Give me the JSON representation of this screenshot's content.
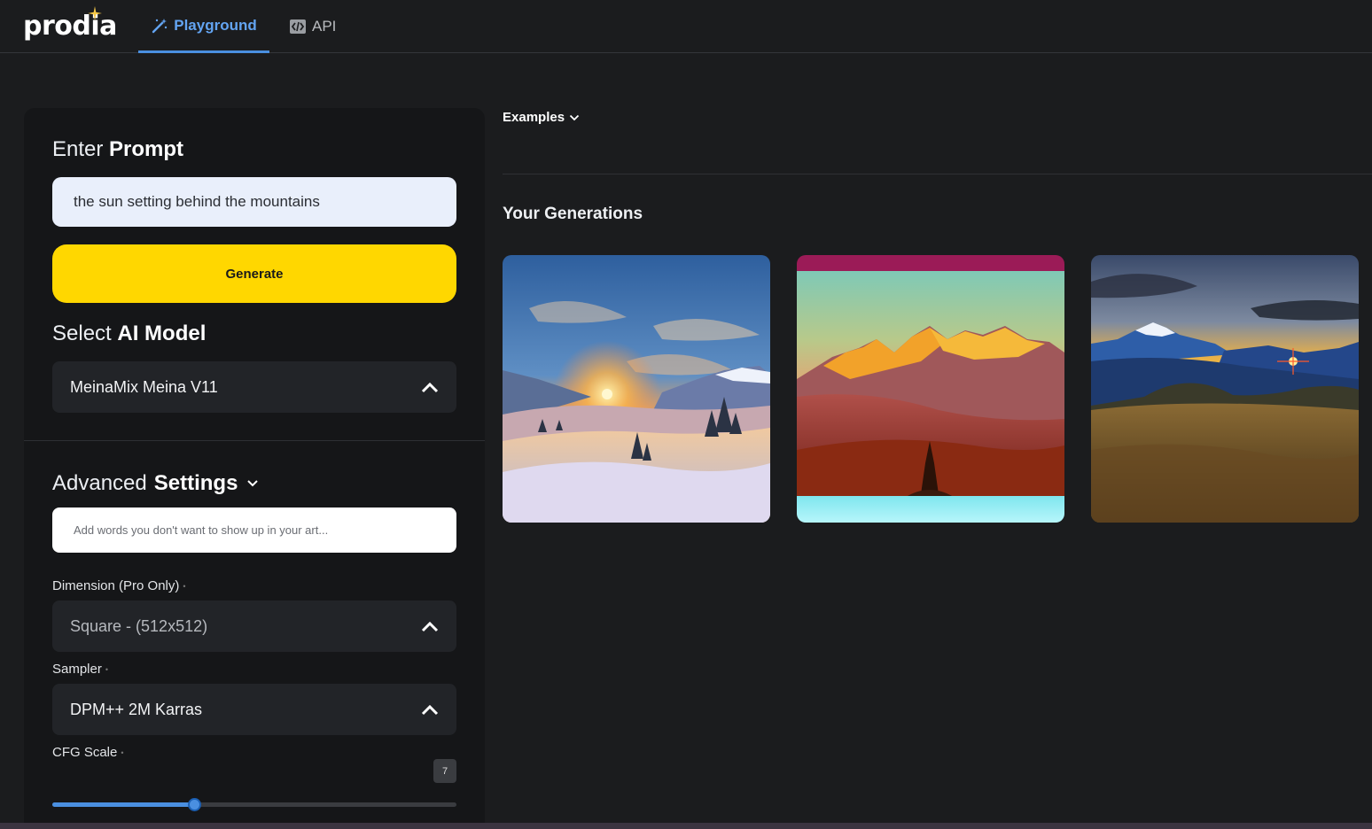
{
  "header": {
    "logo": "prodia",
    "tabs": [
      {
        "label": "Playground",
        "active": true,
        "icon": "magic-wand-icon"
      },
      {
        "label": "API",
        "active": false,
        "icon": "code-icon"
      }
    ]
  },
  "panel": {
    "prompt_title_prefix": "Enter",
    "prompt_title_bold": "Prompt",
    "prompt_value": "the sun setting behind the mountains",
    "generate_label": "Generate",
    "model_title_prefix": "Select",
    "model_title_bold": "AI Model",
    "model_value": "MeinaMix Meina V11",
    "advanced_title_prefix": "Advanced",
    "advanced_title_bold": "Settings",
    "negative_placeholder": "Add words you don't want to show up in your art...",
    "dimension_label": "Dimension (Pro Only)",
    "dimension_value": "Square - (512x512)",
    "sampler_label": "Sampler",
    "sampler_value": "DPM++ 2M Karras",
    "cfg_label": "CFG Scale",
    "cfg_value": "7",
    "cfg_slider_fraction": 0.35
  },
  "main": {
    "examples_label": "Examples",
    "generations_title": "Your Generations",
    "generations": [
      {
        "subject": "snowy-mountain-sunset"
      },
      {
        "subject": "golden-peaks-sunset"
      },
      {
        "subject": "grassland-mountain-sunset"
      }
    ]
  },
  "colors": {
    "background": "#1b1c1e",
    "accent": "#4a8fe0",
    "generate": "#ffd700"
  }
}
